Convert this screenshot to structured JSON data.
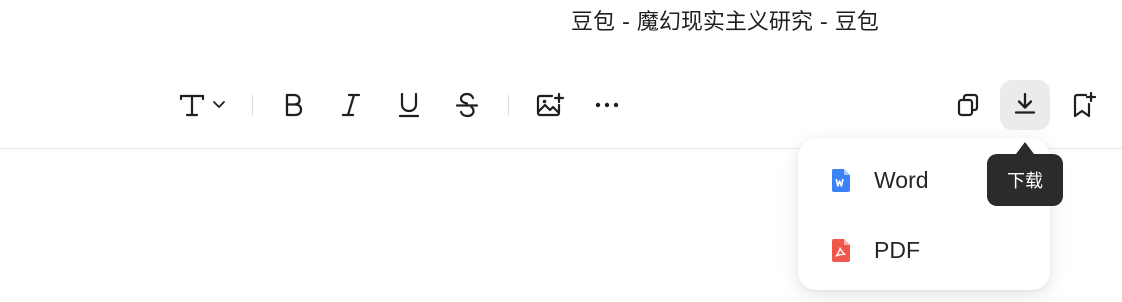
{
  "window": {
    "title": "豆包 - 魔幻现实主义研究 - 豆包"
  },
  "toolbar": {
    "items": [
      {
        "name": "text-style",
        "icon": "text-style-icon",
        "has_dropdown": true
      },
      {
        "name": "bold",
        "icon": "bold-icon"
      },
      {
        "name": "italic",
        "icon": "italic-icon"
      },
      {
        "name": "underline",
        "icon": "underline-icon"
      },
      {
        "name": "strikethrough",
        "icon": "strikethrough-icon"
      },
      {
        "name": "insert-image",
        "icon": "image-add-icon"
      },
      {
        "name": "more",
        "icon": "more-horizontal-icon"
      },
      {
        "name": "copy",
        "icon": "copy-icon"
      },
      {
        "name": "download",
        "icon": "download-icon",
        "active": true
      },
      {
        "name": "bookmark",
        "icon": "bookmark-add-icon"
      }
    ]
  },
  "download_menu": {
    "items": [
      {
        "label": "Word",
        "icon": "word-file-icon",
        "color": "#3b82f6"
      },
      {
        "label": "PDF",
        "icon": "pdf-file-icon",
        "color": "#f0564a"
      }
    ]
  },
  "tooltip": {
    "text": "下载"
  },
  "colors": {
    "icon": "#1f1f1f",
    "active_button_bg": "#ebebed",
    "tooltip_bg": "#2b2b2b",
    "divider": "#e8e8ec"
  }
}
